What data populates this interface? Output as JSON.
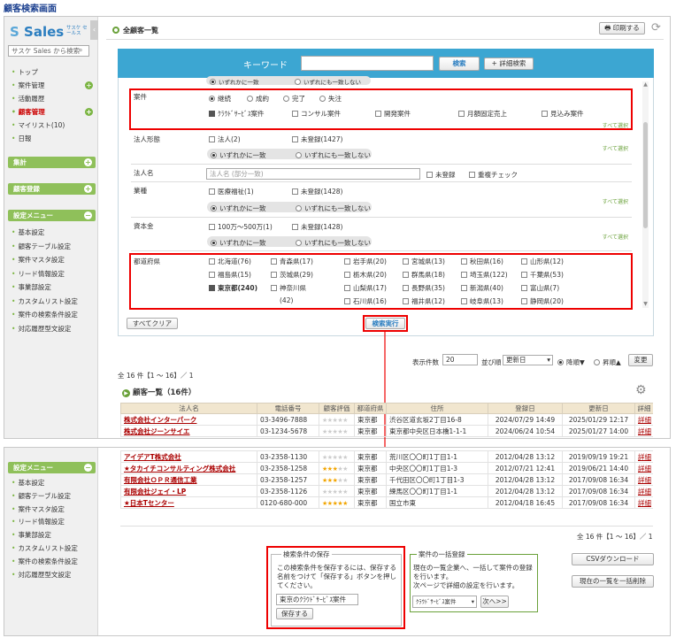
{
  "page_title": "顧客検索画面",
  "logo": {
    "name": "Sales",
    "tagline": "サスケ セールス"
  },
  "sidebar": {
    "search_placeholder": "サスケ Sales から検索",
    "items": [
      {
        "label": "トップ",
        "active": false
      },
      {
        "label": "案件管理",
        "active": false
      },
      {
        "label": "活動履歴",
        "active": false
      },
      {
        "label": "顧客管理",
        "active": true
      },
      {
        "label": "マイリスト(10)",
        "active": false
      },
      {
        "label": "日報",
        "active": false
      }
    ],
    "sections": [
      "集計",
      "顧客登録",
      "設定メニュー"
    ],
    "settings": [
      "基本設定",
      "顧客テーブル設定",
      "案件マスタ設定",
      "リード情報設定",
      "事業部設定",
      "カスタムリスト設定",
      "案件の検索条件設定",
      "対応履歴型文設定"
    ],
    "settings_bottom": [
      "基本設定",
      "顧客テーブル設定",
      "案件マスタ設定",
      "リード情報設定",
      "事業部設定",
      "カスタムリスト設定",
      "案件の検索条件設定",
      "対応履歴型文設定"
    ]
  },
  "header": {
    "title": "全顧客一覧",
    "print_label": "印刷する"
  },
  "keyword": {
    "label": "キーワード",
    "value": "",
    "search_label": "検索",
    "detail_label": "+ 詳細検索"
  },
  "conditions": {
    "top_partial": [
      "いずれかに一致",
      "いずれにも一致しない"
    ],
    "anken": {
      "label": "案件",
      "radios": [
        "継続",
        "成約",
        "完了",
        "失注"
      ],
      "checks": [
        {
          "label": "ｸﾗｳﾄﾞｻｰﾋﾞｽ案件",
          "checked": true
        },
        {
          "label": "コンサル案件",
          "checked": false
        },
        {
          "label": "開発案件",
          "checked": false
        },
        {
          "label": "月額固定売上",
          "checked": false
        },
        {
          "label": "見込み案件",
          "checked": false
        }
      ]
    },
    "select_all": "すべて選択",
    "hojin": {
      "label": "法人形態",
      "opt1": "法人(2)",
      "opt2": "未登録(1427)"
    },
    "match_any": "いずれかに一致",
    "match_none": "いずれにも一致しない",
    "hojin_name": {
      "label": "法人名",
      "placeholder": "法人名 (部分一致)",
      "unreg": "未登録",
      "dup": "重複チェック"
    },
    "gyoshu": {
      "label": "業種",
      "opt1": "医療福祉(1)",
      "opt2": "未登録(1428)"
    },
    "shihon": {
      "label": "資本金",
      "opt1": "100万〜500万(1)",
      "opt2": "未登録(1428)"
    },
    "pref": {
      "label": "都道府県",
      "items": [
        {
          "label": "北海道(76)",
          "checked": false
        },
        {
          "label": "青森県(17)",
          "checked": false
        },
        {
          "label": "岩手県(20)",
          "checked": false
        },
        {
          "label": "宮城県(13)",
          "checked": false
        },
        {
          "label": "秋田県(16)",
          "checked": false
        },
        {
          "label": "山形県(12)",
          "checked": false
        },
        {
          "label": "福島県(15)",
          "checked": false
        },
        {
          "label": "茨城県(29)",
          "checked": false
        },
        {
          "label": "栃木県(20)",
          "checked": false
        },
        {
          "label": "群馬県(18)",
          "checked": false
        },
        {
          "label": "埼玉県(122)",
          "checked": false
        },
        {
          "label": "千葉県(53)",
          "checked": false
        },
        {
          "label": "東京都(240)",
          "checked": true
        },
        {
          "label": "神奈川県",
          "checked": false
        },
        {
          "label": "山梨県(17)",
          "checked": false
        },
        {
          "label": "長野県(35)",
          "checked": false
        },
        {
          "label": "新潟県(40)",
          "checked": false
        },
        {
          "label": "富山県(7)",
          "checked": false
        },
        {
          "label": "(42)",
          "checked": false
        },
        {
          "label": "石川県(16)",
          "checked": false
        },
        {
          "label": "福井県(12)",
          "checked": false
        },
        {
          "label": "岐阜県(13)",
          "checked": false
        },
        {
          "label": "静岡県(20)",
          "checked": false
        }
      ]
    },
    "clear_label": "すべてクリア",
    "exec_label": "検索実行"
  },
  "results": {
    "count_text": "全 16 件【1 〜 16】／ 1",
    "per_page_label": "表示件数",
    "per_page_value": "20",
    "sort_label": "並び順",
    "sort_value": "更新日",
    "desc_label": "降順▼",
    "asc_label": "昇順▲",
    "change_label": "変更",
    "list_title": "顧客一覧（16件）",
    "columns": [
      "法人名",
      "電話番号",
      "顧客評価",
      "都道府県",
      "住所",
      "登録日",
      "更新日",
      "詳細"
    ],
    "rows_top": [
      {
        "name": "株式会社インターパーク",
        "tel": "03-3496-7888",
        "stars": 0,
        "pref": "東京都",
        "addr": "渋谷区道玄坂2丁目16-8",
        "reg": "2024/07/29 14:49",
        "upd": "2025/01/29 12:17",
        "det": "詳細"
      },
      {
        "name": "株式会社ジーンサイエ",
        "tel": "03-1234-5678",
        "stars": 0,
        "pref": "東京都",
        "addr": "東京都中央区日本橋1-1-1",
        "reg": "2024/06/24 10:54",
        "upd": "2025/01/27 14:00",
        "det": "詳細"
      }
    ],
    "rows_bottom": [
      {
        "name": "アイデアT株式会社",
        "tel": "03-2358-1130",
        "stars": 0,
        "pref": "東京都",
        "addr": "荒川区〇〇町1丁目1-1",
        "reg": "2012/04/28 13:12",
        "upd": "2019/09/19 19:21",
        "det": "詳細"
      },
      {
        "name": "★タカイチコンサルティング株式会社",
        "tel": "03-2358-1258",
        "stars": 3,
        "pref": "東京都",
        "addr": "中央区〇〇町1丁目1-3",
        "reg": "2012/07/21 12:41",
        "upd": "2019/06/21 14:40",
        "det": "詳細"
      },
      {
        "name": "有限会社ＯＰＲ通信工業",
        "tel": "03-2358-1257",
        "stars": 3,
        "pref": "東京都",
        "addr": "千代田区〇〇町1丁目1-3",
        "reg": "2012/04/28 13:12",
        "upd": "2017/09/08 16:34",
        "det": "詳細"
      },
      {
        "name": "有限会社ジェイ・LP",
        "tel": "03-2358-1126",
        "stars": 0,
        "pref": "東京都",
        "addr": "練馬区〇〇町1丁目1-1",
        "reg": "2012/04/28 13:12",
        "upd": "2017/09/08 16:34",
        "det": "詳細"
      },
      {
        "name": "★日本Tセンター",
        "tel": "0120-680-000",
        "stars": 5,
        "pref": "東京都",
        "addr": "国立市東",
        "reg": "2012/04/18 16:45",
        "upd": "2017/09/08 16:34",
        "det": "詳細"
      }
    ]
  },
  "save_box": {
    "title": "検索条件の保存",
    "desc": [
      "この検索条件を保存するには、保存する",
      "名前をつけて「保存する」ボタンを押し",
      "てください。"
    ],
    "name_value": "東京のｸﾗｳﾄﾞｻｰﾋﾞｽ案件",
    "save_label": "保存する"
  },
  "bulk_box": {
    "title": "案件の一括登録",
    "desc": [
      "現在の一覧企業へ、一括して案件の登録",
      "を行います。",
      "次ページで詳細の設定を行います。"
    ],
    "select_value": "ｸﾗｳﾄﾞｻｰﾋﾞｽ案件",
    "next_label": "次へ>>"
  },
  "csv_label": "CSVダウンロード",
  "bulk_delete_label": "現在の一覧を一括削除"
}
